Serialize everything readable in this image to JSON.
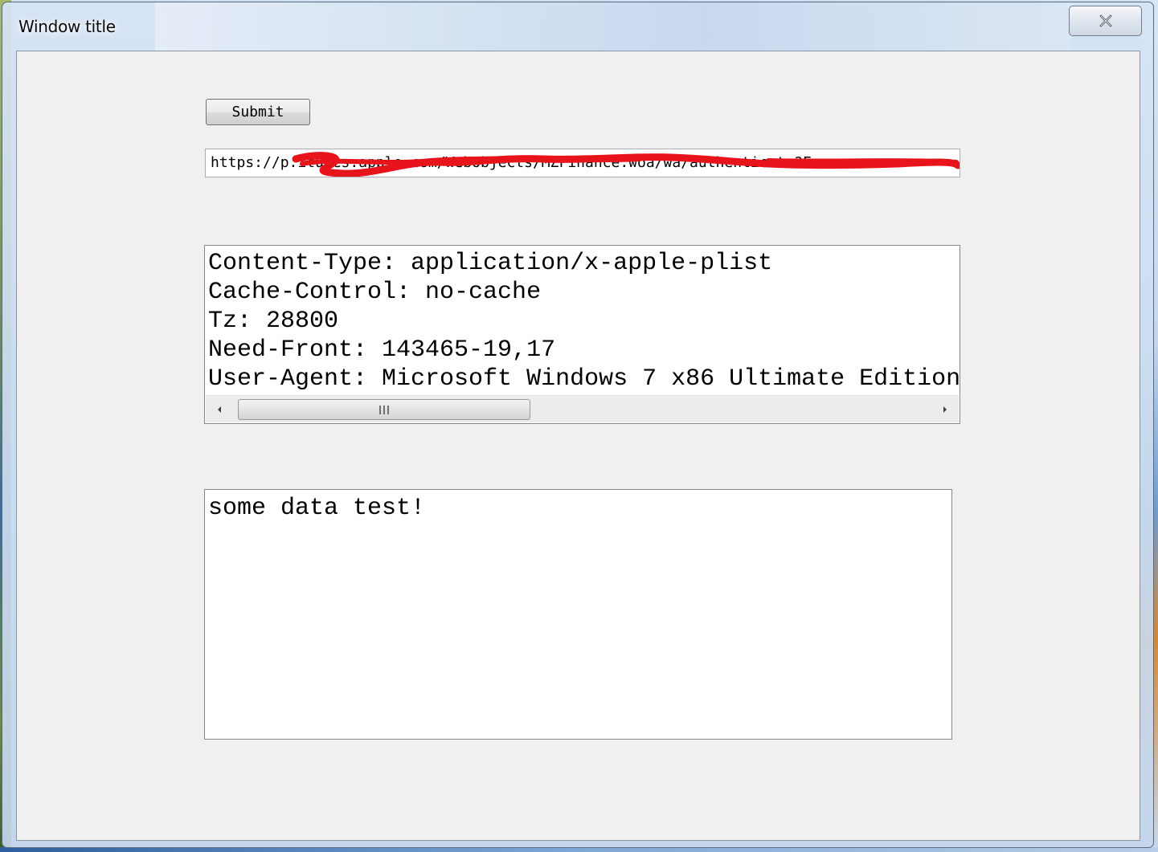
{
  "window": {
    "title": "Window title"
  },
  "form": {
    "submit_label": "Submit",
    "url_value": "https://p.itunes.apple.com/WebObjects/MZFinance.woa/wa/authenticate?F...",
    "headers_text": "Content-Type: application/x-apple-plist\nCache-Control: no-cache\nTz: 28800\nNeed-Front: 143465-19,17\nUser-Agent: Microsoft Windows 7 x86 Ultimate Edition",
    "data_text": "some data test!"
  },
  "icons": {
    "close": "close-icon",
    "scroll_left": "arrow-left-icon",
    "scroll_right": "arrow-right-icon",
    "scroll_grip": "grip-icon"
  },
  "colors": {
    "client_background": "#f0f0f0",
    "redaction": "#e8141c"
  }
}
